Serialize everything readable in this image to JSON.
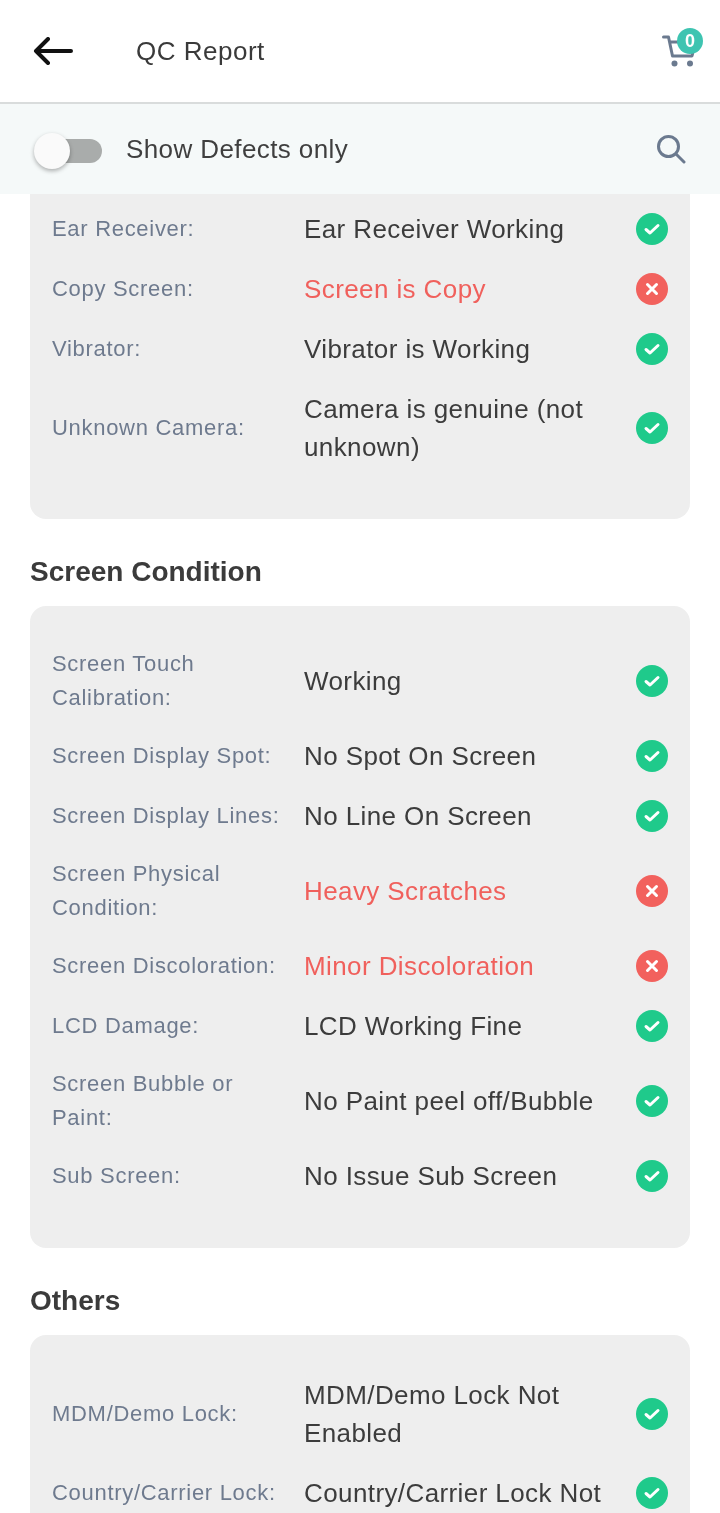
{
  "header": {
    "title": "QC Report",
    "cart_count": "0"
  },
  "filter": {
    "label": "Show Defects only",
    "on": false
  },
  "sections": [
    {
      "rows": [
        {
          "label": "Ear Receiver:",
          "value": "Ear Receiver Working",
          "defect": false
        },
        {
          "label": "Copy Screen:",
          "value": "Screen is Copy",
          "defect": true
        },
        {
          "label": "Vibrator:",
          "value": "Vibrator is Working",
          "defect": false
        },
        {
          "label": "Unknown Camera:",
          "value": "Camera is genuine (not unknown)",
          "defect": false
        }
      ]
    },
    {
      "title": "Screen Condition",
      "rows": [
        {
          "label": "Screen Touch Calibration:",
          "value": "Working",
          "defect": false
        },
        {
          "label": "Screen Display Spot:",
          "value": "No Spot On Screen",
          "defect": false
        },
        {
          "label": "Screen Display Lines:",
          "value": "No Line On Screen",
          "defect": false
        },
        {
          "label": "Screen Physical Condition:",
          "value": "Heavy Scratches",
          "defect": true
        },
        {
          "label": "Screen Discoloration:",
          "value": "Minor Discoloration",
          "defect": true
        },
        {
          "label": "LCD Damage:",
          "value": "LCD Working Fine",
          "defect": false
        },
        {
          "label": "Screen Bubble or Paint:",
          "value": "No Paint peel off/Bubble",
          "defect": false
        },
        {
          "label": "Sub Screen:",
          "value": "No Issue Sub Screen",
          "defect": false
        }
      ]
    },
    {
      "title": "Others",
      "rows": [
        {
          "label": "MDM/Demo Lock:",
          "value": "MDM/Demo Lock Not Enabled",
          "defect": false
        },
        {
          "label": "Country/Carrier Lock:",
          "value": "Country/Carrier Lock Not",
          "defect": false
        }
      ]
    }
  ]
}
